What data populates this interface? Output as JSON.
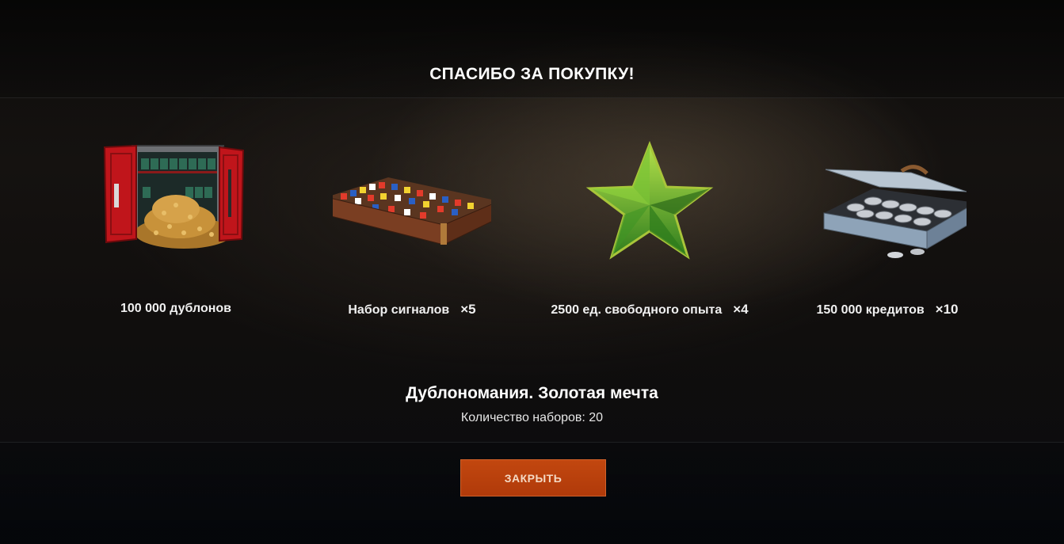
{
  "dialog": {
    "title": "СПАСИБО ЗА ПОКУПКУ!",
    "rewards": [
      {
        "label": "100 000 дублонов",
        "multiplier": "",
        "icon": "gold-safe-icon"
      },
      {
        "label": "Набор сигналов",
        "multiplier": "×5",
        "icon": "signal-flags-box-icon"
      },
      {
        "label": "2500 ед. свободного опыта",
        "multiplier": "×4",
        "icon": "free-xp-star-icon"
      },
      {
        "label": "150 000 кредитов",
        "multiplier": "×10",
        "icon": "credits-box-icon"
      }
    ],
    "pack_name": "Дублономания. Золотая мечта",
    "pack_count": "Количество наборов: 20",
    "close_label": "ЗАКРЫТЬ"
  },
  "colors": {
    "accent_button": "#b8400c",
    "star_green": "#4caf2a",
    "safe_red": "#c0151b"
  }
}
